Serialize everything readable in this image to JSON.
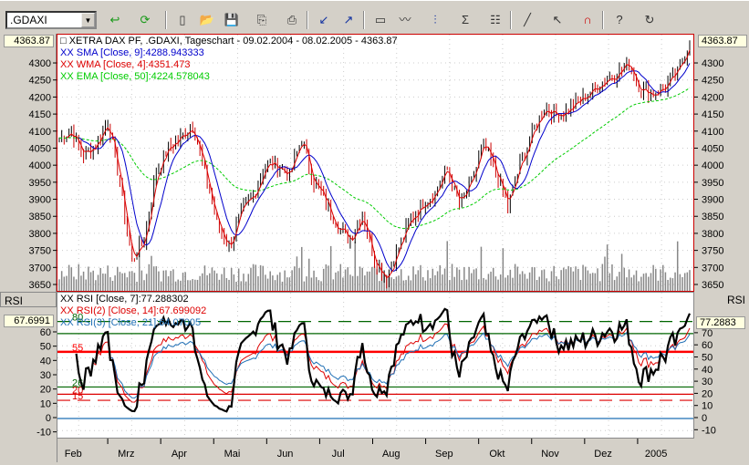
{
  "toolbar": {
    "symbol": ".GDAXI",
    "icons": [
      "go-arrow-icon",
      "refresh-icon",
      "new-icon",
      "open-folder-icon",
      "save-icon",
      "copy-icon",
      "print-icon",
      "chart-back-icon",
      "chart-forward-icon",
      "window-icon",
      "indicator-icon",
      "chart-style-icon",
      "sigma-icon",
      "properties-icon",
      "draw-line-icon",
      "cursor-icon",
      "magnet-icon",
      "help-icon",
      "undo-icon"
    ]
  },
  "main": {
    "title": "XETRA DAX PF, .GDAXI, Tageschart - 09.02.2004 - 08.02.2005 - 4363.87",
    "last_left": "4363.87",
    "last_right": "4363.87",
    "legend": [
      {
        "text": "XX SMA [Close, 9]:4288.943333",
        "color": "#0000cc"
      },
      {
        "text": "XX WMA [Close, 4]:4351.473",
        "color": "#dd0000"
      },
      {
        "text": "XX EMA [Close, 50]:4224.578043",
        "color": "#00cc00"
      }
    ]
  },
  "rsi": {
    "label_left": "RSI",
    "label_right": "RSI",
    "last_left": "67.6991",
    "last_right": "77.2883",
    "legend": [
      {
        "text": "XX RSI [Close, 7]:77.288302",
        "color": "#000000"
      },
      {
        "text": "XX RSI(2) [Close, 14]:67.699092",
        "color": "#dd0000"
      },
      {
        "text": "XX RSI(3) [Close, 21]:64.07005",
        "color": "#1f6fb5"
      }
    ],
    "levels": [
      {
        "v": 80,
        "label": "80",
        "color": "#006600",
        "dash": true
      },
      {
        "v": 70,
        "label": "",
        "color": "#006600",
        "dash": false
      },
      {
        "v": 55,
        "label": "55",
        "color": "#ff0000",
        "dash": false,
        "thick": true
      },
      {
        "v": 26,
        "label": "26",
        "color": "#006600",
        "dash": false
      },
      {
        "v": 20,
        "label": "20",
        "color": "#dd0000",
        "dash": false
      },
      {
        "v": 15,
        "label": "15",
        "color": "#dd0000",
        "dash": true
      },
      {
        "v": 0,
        "label": "",
        "color": "#1f6fb5",
        "dash": false
      }
    ]
  },
  "chart_data": {
    "type": "line",
    "title": "XETRA DAX PF, .GDAXI, Tageschart - 09.02.2004 - 08.02.2005 - 4363.87",
    "price_ticks": [
      3650,
      3700,
      3750,
      3800,
      3850,
      3900,
      3950,
      4000,
      4050,
      4100,
      4150,
      4200,
      4250,
      4300
    ],
    "ylim": [
      3630,
      4380
    ],
    "rsi_ticks_left": [
      -10,
      0,
      10,
      20,
      30,
      40,
      50,
      60
    ],
    "rsi_ticks_right": [
      -10,
      0,
      10,
      20,
      30,
      40,
      50,
      60,
      70
    ],
    "months": [
      "Feb",
      "Mrz",
      "Apr",
      "Mai",
      "Jun",
      "Jul",
      "Aug",
      "Sep",
      "Okt",
      "Nov",
      "Dez",
      "2005"
    ],
    "weekly_close": [
      4080,
      4100,
      4030,
      4060,
      4130,
      3950,
      3720,
      3780,
      3980,
      4050,
      4080,
      4120,
      3980,
      3830,
      3760,
      3860,
      3910,
      4000,
      4000,
      3970,
      4080,
      3950,
      3890,
      3820,
      3780,
      3860,
      3720,
      3670,
      3760,
      3840,
      3890,
      3920,
      3990,
      3880,
      3950,
      4060,
      3980,
      3880,
      4000,
      4090,
      4170,
      4150,
      4160,
      4190,
      4220,
      4250,
      4270,
      4300,
      4220,
      4210,
      4230,
      4270,
      4364
    ]
  }
}
